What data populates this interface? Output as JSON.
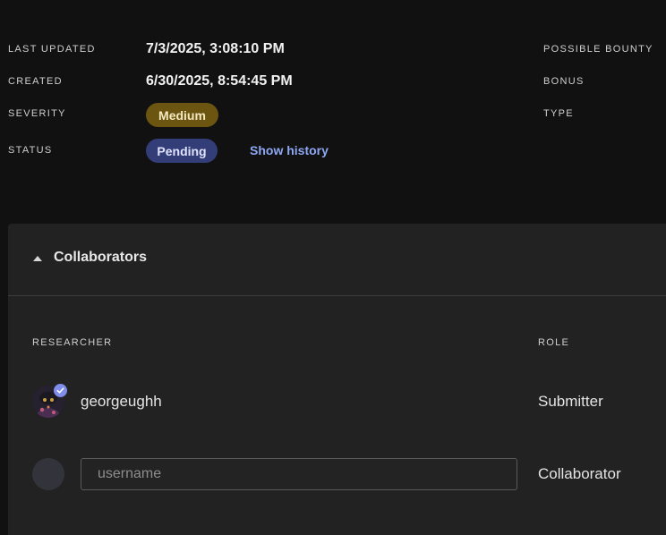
{
  "meta": {
    "last_updated_label": "LAST UPDATED",
    "last_updated_value": "7/3/2025, 3:08:10 PM",
    "created_label": "CREATED",
    "created_value": "6/30/2025, 8:54:45 PM",
    "severity_label": "SEVERITY",
    "severity_value": "Medium",
    "status_label": "STATUS",
    "status_value": "Pending",
    "show_history": "Show history",
    "possible_bounty_label": "POSSIBLE BOUNTY",
    "bonus_label": "BONUS",
    "type_label": "TYPE"
  },
  "colors": {
    "severity_medium": "#6b5510",
    "status_pending": "#333d78",
    "link": "#8ea7f2"
  },
  "collaborators": {
    "title": "Collaborators",
    "researcher_header": "RESEARCHER",
    "role_header": "ROLE",
    "rows": [
      {
        "username": "georgeughh",
        "role": "Submitter",
        "verified": true
      },
      {
        "role": "Collaborator"
      }
    ],
    "input": {
      "placeholder": "username",
      "value": ""
    }
  }
}
